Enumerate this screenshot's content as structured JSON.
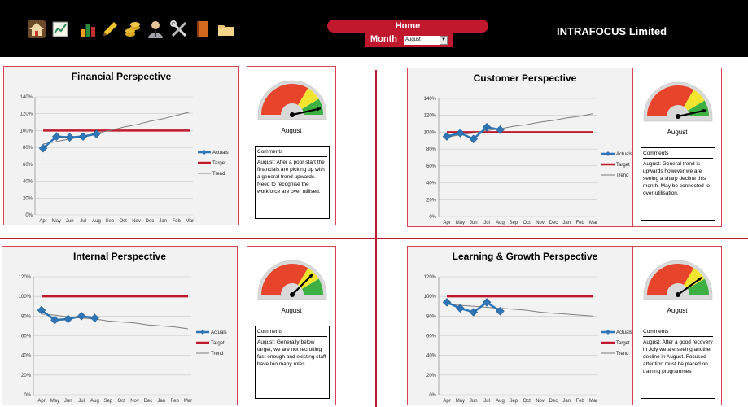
{
  "toolbar": {
    "icons": [
      "home-icon",
      "chart-icon",
      "bar-chart-icon",
      "pencil-icon",
      "coins-icon",
      "person-icon",
      "tools-icon",
      "book-icon",
      "folder-icon"
    ],
    "home_label": "Home",
    "month_label": "Month",
    "month_value": "August",
    "company": "INTRAFOCUS Limited"
  },
  "colors": {
    "accent": "#c0192d",
    "actuals": "#2e75b6",
    "target": "#c0192d",
    "trend": "#7f7f7f"
  },
  "legend": {
    "actuals": "Actuals",
    "target": "Target",
    "trend": "Trend"
  },
  "months": [
    "Apr",
    "May",
    "Jun",
    "Jul",
    "Aug",
    "Sep",
    "Oct",
    "Nov",
    "Dec",
    "Jan",
    "Feb",
    "Mar"
  ],
  "panels": [
    {
      "title": "Financial Perspective",
      "gauge_month": "August",
      "gauge_level": 0.93,
      "comments_header": "Comments",
      "comment": "August: After a poor start the financials are picking up with a general trend upwards.  Need to recognise the workforce are over utilised."
    },
    {
      "title": "Customer Perspective",
      "gauge_month": "August",
      "gauge_level": 0.93,
      "comments_header": "Comments",
      "comment": "August: General trend is upwards however we are seeing a sharp decline this month.  May be connected to over-utilisation."
    },
    {
      "title": "Internal Perspective",
      "gauge_month": "August",
      "gauge_level": 0.75,
      "comments_header": "Comments",
      "comment": "August: Generally below target, we are not recruiting fast enough and existing staff have too many roles."
    },
    {
      "title": "Learning & Growth Perspective",
      "gauge_month": "August",
      "gauge_level": 0.8,
      "comments_header": "Comments",
      "comment": "August: After a good recovery in July we are seeing another decline in August.  Focused attention must be placed on training programmes"
    }
  ],
  "chart_data": [
    {
      "type": "line",
      "title": "Financial Perspective",
      "categories": [
        "Apr",
        "May",
        "Jun",
        "Jul",
        "Aug",
        "Sep",
        "Oct",
        "Nov",
        "Dec",
        "Jan",
        "Feb",
        "Mar"
      ],
      "yticks": [
        "0%",
        "20%",
        "40%",
        "60%",
        "80%",
        "100%",
        "120%",
        "140%"
      ],
      "ylim": [
        0,
        140
      ],
      "series": [
        {
          "name": "Actuals",
          "values": [
            79,
            93,
            92,
            93,
            96
          ]
        },
        {
          "name": "Target",
          "values": [
            100,
            100,
            100,
            100,
            100,
            100,
            100,
            100,
            100,
            100,
            100,
            100
          ]
        },
        {
          "name": "Trend",
          "values": [
            84,
            87,
            90,
            93,
            97,
            100,
            104,
            107,
            111,
            114,
            118,
            122
          ]
        }
      ],
      "legend": "right"
    },
    {
      "type": "line",
      "title": "Customer Perspective",
      "categories": [
        "Apr",
        "May",
        "Jun",
        "Jul",
        "Aug",
        "Sep",
        "Oct",
        "Nov",
        "Dec",
        "Jan",
        "Feb",
        "Mar"
      ],
      "yticks": [
        "0%",
        "20%",
        "40%",
        "60%",
        "80%",
        "100%",
        "120%",
        "140%"
      ],
      "ylim": [
        0,
        140
      ],
      "series": [
        {
          "name": "Actuals",
          "values": [
            95,
            99,
            92,
            106,
            103
          ]
        },
        {
          "name": "Target",
          "values": [
            100,
            100,
            100,
            100,
            100,
            100,
            100,
            100,
            100,
            100,
            100,
            100
          ]
        },
        {
          "name": "Trend",
          "values": [
            94,
            97,
            99,
            102,
            104,
            107,
            109,
            112,
            114,
            117,
            119,
            122
          ]
        }
      ],
      "legend": "right"
    },
    {
      "type": "line",
      "title": "Internal Perspective",
      "categories": [
        "Apr",
        "May",
        "Jun",
        "Jul",
        "Aug",
        "Sep",
        "Oct",
        "Nov",
        "Dec",
        "Jan",
        "Feb",
        "Mar"
      ],
      "yticks": [
        "0%",
        "20%",
        "40%",
        "60%",
        "80%",
        "100%",
        "120%"
      ],
      "ylim": [
        0,
        120
      ],
      "series": [
        {
          "name": "Actuals",
          "values": [
            86,
            76,
            77,
            80,
            78
          ]
        },
        {
          "name": "Target",
          "values": [
            100,
            100,
            100,
            100,
            100,
            100,
            100,
            100,
            100,
            100,
            100,
            100
          ]
        },
        {
          "name": "Trend",
          "values": [
            82,
            81,
            79,
            78,
            77,
            75,
            74,
            73,
            71,
            70,
            69,
            67
          ]
        }
      ],
      "legend": "right"
    },
    {
      "type": "line",
      "title": "Learning & Growth Perspective",
      "categories": [
        "Apr",
        "May",
        "Jun",
        "Jul",
        "Aug",
        "Sep",
        "Oct",
        "Nov",
        "Dec",
        "Jan",
        "Feb",
        "Mar"
      ],
      "yticks": [
        "0%",
        "20%",
        "40%",
        "60%",
        "80%",
        "100%",
        "120%"
      ],
      "ylim": [
        0,
        120
      ],
      "series": [
        {
          "name": "Actuals",
          "values": [
            94,
            88,
            84,
            94,
            85
          ]
        },
        {
          "name": "Target",
          "values": [
            100,
            100,
            100,
            100,
            100,
            100,
            100,
            100,
            100,
            100,
            100,
            100
          ]
        },
        {
          "name": "Trend",
          "values": [
            92,
            91,
            90,
            89,
            88,
            87,
            86,
            84,
            83,
            82,
            81,
            80
          ]
        }
      ],
      "legend": "right"
    }
  ]
}
